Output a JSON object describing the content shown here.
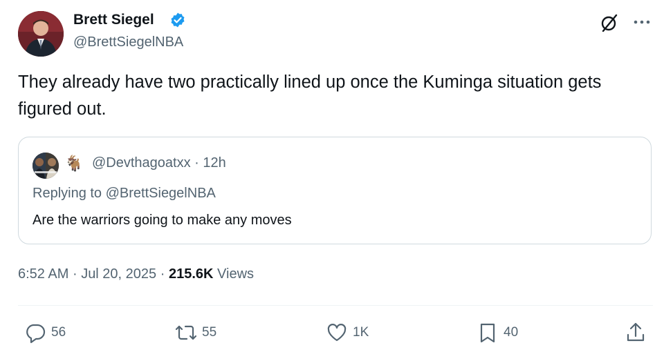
{
  "author": {
    "name": "Brett Siegel",
    "handle": "@BrettSiegelNBA",
    "verified_color": "#1d9bf0"
  },
  "tweet": {
    "text": "They already have two practically lined up once the Kuminga situation gets figured out."
  },
  "quoted": {
    "emoji": "🐐",
    "handle_time": "@Devthagoatxx · 12h",
    "replying_to": "Replying to @BrettSiegelNBA",
    "text": "Are the warriors going to make any moves"
  },
  "meta": {
    "time": "6:52 AM",
    "date": "Jul 20, 2025",
    "views_count": "215.6K",
    "views_label": "Views",
    "separator": "·"
  },
  "actions": {
    "replies": "56",
    "reposts": "55",
    "likes": "1K",
    "bookmarks": "40"
  },
  "icons": [
    "verified-badge-icon",
    "grok-icon",
    "more-icon",
    "reply-icon",
    "repost-icon",
    "like-icon",
    "bookmark-icon",
    "share-icon"
  ]
}
